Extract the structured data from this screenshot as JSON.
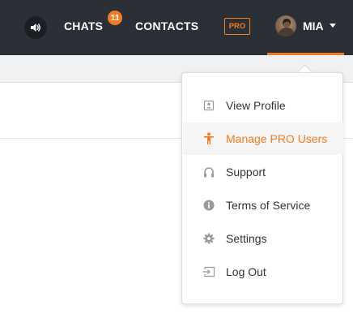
{
  "colors": {
    "accent": "#f47b20",
    "topbar_bg": "#2b3037",
    "menu_text": "#333333",
    "menu_icon": "#9a9a9a"
  },
  "header": {
    "sound_icon": "speaker-icon",
    "chats_label": "CHATS",
    "chats_badge": "11",
    "contacts_label": "CONTACTS",
    "pro_label": "PRO",
    "user": {
      "name": "MIA",
      "avatar_icon": "avatar",
      "caret_icon": "caret-down-icon"
    }
  },
  "menu": {
    "items": [
      {
        "label": "View Profile",
        "icon": "profile-card-icon",
        "active": false
      },
      {
        "label": "Manage PRO Users",
        "icon": "person-icon",
        "active": true
      },
      {
        "label": "Support",
        "icon": "headset-icon",
        "active": false
      },
      {
        "label": "Terms of Service",
        "icon": "info-icon",
        "active": false
      },
      {
        "label": "Settings",
        "icon": "gear-icon",
        "active": false
      },
      {
        "label": "Log Out",
        "icon": "logout-icon",
        "active": false
      }
    ]
  }
}
